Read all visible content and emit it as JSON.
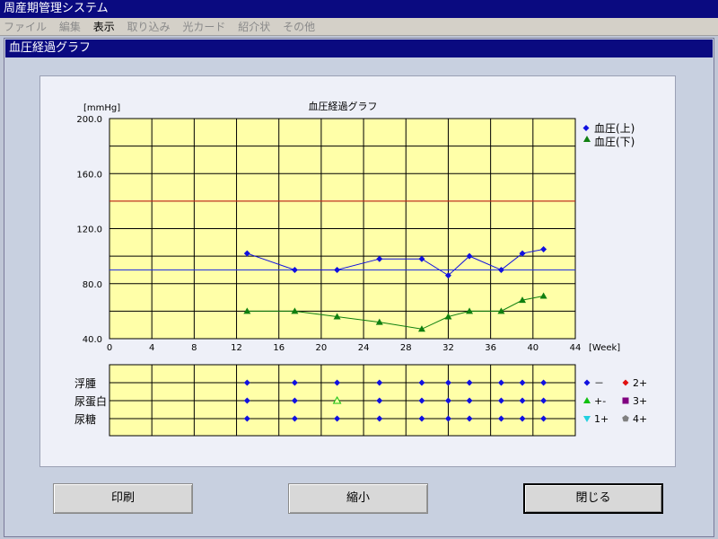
{
  "window": {
    "title": "周産期管理システム"
  },
  "menu": [
    {
      "label": "ファイル",
      "enabled": false
    },
    {
      "label": "編集",
      "enabled": false
    },
    {
      "label": "表示",
      "enabled": true
    },
    {
      "label": "取り込み",
      "enabled": false
    },
    {
      "label": "光カード",
      "enabled": false
    },
    {
      "label": "紹介状",
      "enabled": false
    },
    {
      "label": "その他",
      "enabled": false
    }
  ],
  "subwindow": {
    "title": "血圧経過グラフ"
  },
  "chart_data": {
    "type": "line",
    "title": "血圧経過グラフ",
    "ylabel": "[mmHg]",
    "xlabel": "[Week]",
    "xlim": [
      0,
      44
    ],
    "ylim": [
      40,
      200
    ],
    "xticks": [
      0,
      4,
      8,
      12,
      16,
      20,
      24,
      28,
      32,
      36,
      40,
      44
    ],
    "yticks": [
      "40.0",
      "80.0",
      "120.0",
      "160.0",
      "200.0"
    ],
    "reference_lines": [
      {
        "y": 140,
        "color": "#e03020"
      },
      {
        "y": 90,
        "color": "#2030e0"
      }
    ],
    "series": [
      {
        "name": "血圧(上)",
        "color": "#1010e0",
        "marker": "diamond",
        "x": [
          13,
          17.5,
          21.5,
          25.5,
          29.5,
          32,
          34,
          37,
          39,
          41
        ],
        "y": [
          102,
          90,
          90,
          98,
          98,
          86,
          100,
          90,
          102,
          105
        ]
      },
      {
        "name": "血圧(下)",
        "color": "#108010",
        "marker": "triangle",
        "x": [
          13,
          17.5,
          21.5,
          25.5,
          29.5,
          32,
          34,
          37,
          39,
          41
        ],
        "y": [
          60,
          60,
          56,
          52,
          47,
          56,
          60,
          60,
          68,
          71
        ]
      }
    ],
    "urine": {
      "rows": [
        "浮腫",
        "尿蛋白",
        "尿糖"
      ],
      "x": [
        13,
        17.5,
        21.5,
        25.5,
        29.5,
        32,
        34,
        37,
        39,
        41
      ],
      "values": [
        [
          "-",
          "-",
          "-",
          "-",
          "-",
          "-",
          "-",
          "-",
          "-",
          "-"
        ],
        [
          "-",
          "-",
          "+-",
          "-",
          "-",
          "-",
          "-",
          "-",
          "-",
          "-"
        ],
        [
          "-",
          "-",
          "-",
          "-",
          "-",
          "-",
          "-",
          "-",
          "-",
          "-"
        ]
      ],
      "legend": [
        {
          "label": "－",
          "key": "-",
          "color": "#1010e0",
          "marker": "diamond"
        },
        {
          "label": "2+",
          "key": "2+",
          "color": "#e01010",
          "marker": "diamond"
        },
        {
          "label": "+-",
          "key": "+-",
          "color": "#10c010",
          "marker": "triangle"
        },
        {
          "label": "3+",
          "key": "3+",
          "color": "#800080",
          "marker": "square"
        },
        {
          "label": "1+",
          "key": "1+",
          "color": "#20d0e0",
          "marker": "triangle-down"
        },
        {
          "label": "4+",
          "key": "4+",
          "color": "#808080",
          "marker": "pentagon"
        }
      ]
    }
  },
  "buttons": {
    "print": "印刷",
    "shrink": "縮小",
    "close": "閉じる"
  }
}
